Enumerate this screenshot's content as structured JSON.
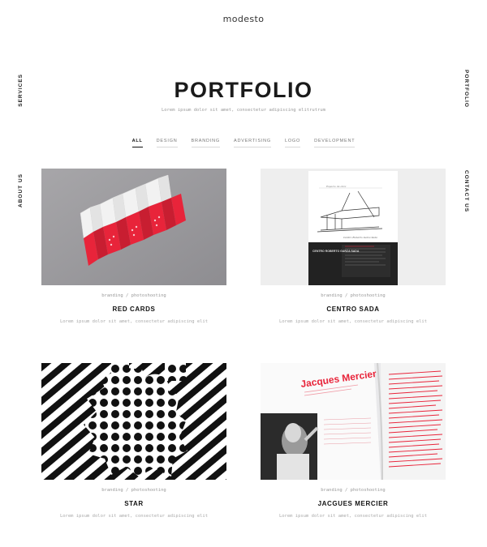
{
  "logo": "modesto",
  "side_nav": {
    "services": "SERVICES",
    "about": "ABOUT US",
    "portfolio": "PORTFOLIO",
    "contact": "CONTACT US"
  },
  "header": {
    "title": "PORTFOLIO",
    "subtitle": "Lorem ipsum dolor sit amet, consectetur adipiscing elitrutrum"
  },
  "filters": [
    "ALL",
    "DESIGN",
    "BRANDING",
    "ADVERTISING",
    "LOGO",
    "DEVELOPMENT"
  ],
  "active_filter": "ALL",
  "colors": {
    "accent": "#e8243a",
    "dark": "#1a1a1a",
    "muted": "#999999"
  },
  "items": [
    {
      "tags": "branding / photoshooting",
      "title": "RED CARDS",
      "desc": "Lorem ipsum dolor sit amet, consectetur adipiscing elit"
    },
    {
      "tags": "branding / photoshooting",
      "title": "CENTRO SADA",
      "desc": "Lorem ipsum dolor sit amet, consectetur adipiscing elit",
      "image_text": {
        "caption": "Espacio de obra",
        "sign": "Centro Roberto Garza Sada",
        "brand": "CENTRO ROBERTO GARZA SADA"
      }
    },
    {
      "tags": "branding / photoshooting",
      "title": "STAR",
      "desc": "Lorem ipsum dolor sit amet, consectetur adipiscing elit"
    },
    {
      "tags": "branding / photoshooting",
      "title": "JACGUES MERCIER",
      "desc": "Lorem ipsum dolor sit amet, consectetur adipiscing elit",
      "image_text": {
        "heading": "Jacques Mercier"
      }
    }
  ]
}
